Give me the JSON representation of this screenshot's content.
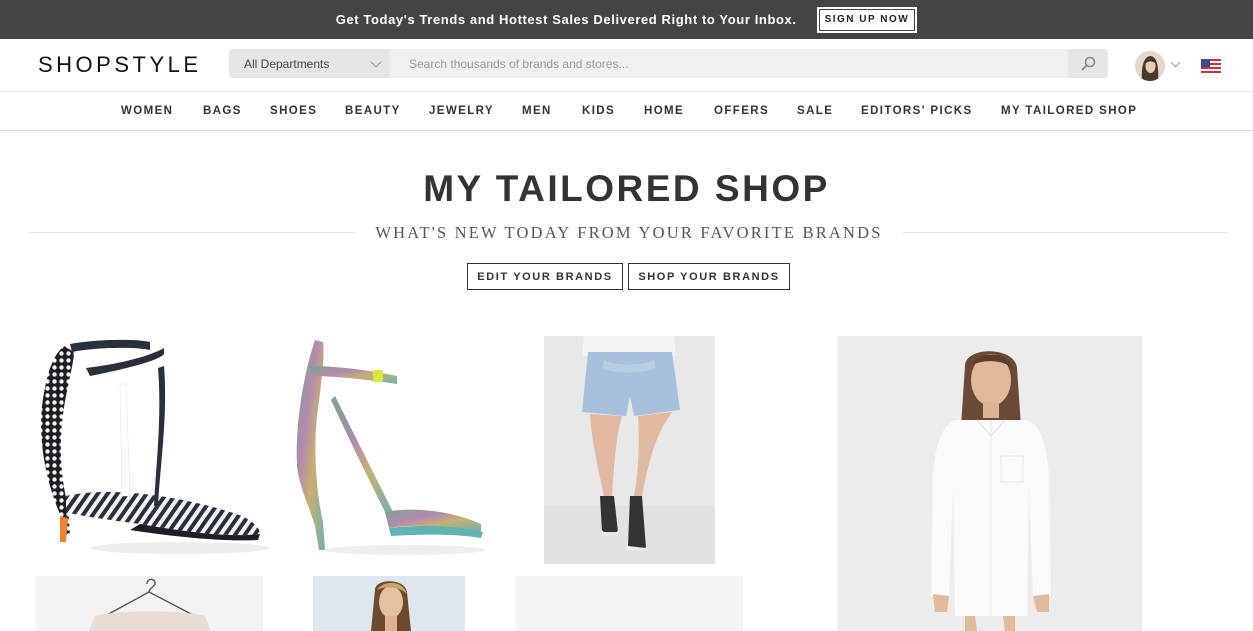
{
  "promo": {
    "text": "Get Today's Trends and Hottest Sales Delivered Right to Your Inbox.",
    "button": "SIGN UP NOW"
  },
  "header": {
    "logo": "SHOPSTYLE",
    "department": "All Departments",
    "search_placeholder": "Search thousands of brands and stores..."
  },
  "nav": [
    "WOMEN",
    "BAGS",
    "SHOES",
    "BEAUTY",
    "JEWELRY",
    "MEN",
    "KIDS",
    "HOME",
    "OFFERS",
    "SALE",
    "EDITORS' PICKS",
    "MY TAILORED SHOP"
  ],
  "hero": {
    "title": "MY TAILORED SHOP",
    "subtitle": "WHAT'S NEW TODAY FROM YOUR FAVORITE BRANDS",
    "edit_button": "EDIT YOUR BRANDS",
    "shop_button": "SHOP YOUR BRANDS"
  },
  "products": [
    {
      "kind": "patterned-heel-sandal"
    },
    {
      "kind": "iridescent-heel-sandal"
    },
    {
      "kind": "chambray-shorts"
    },
    {
      "kind": "white-shirt-dress"
    },
    {
      "kind": "hanger-top"
    },
    {
      "kind": "model-portrait"
    },
    {
      "kind": "placeholder"
    }
  ],
  "colors": {
    "promo_bg": "#444444",
    "text_dark": "#333333",
    "search_bg": "#f0f0f0"
  }
}
